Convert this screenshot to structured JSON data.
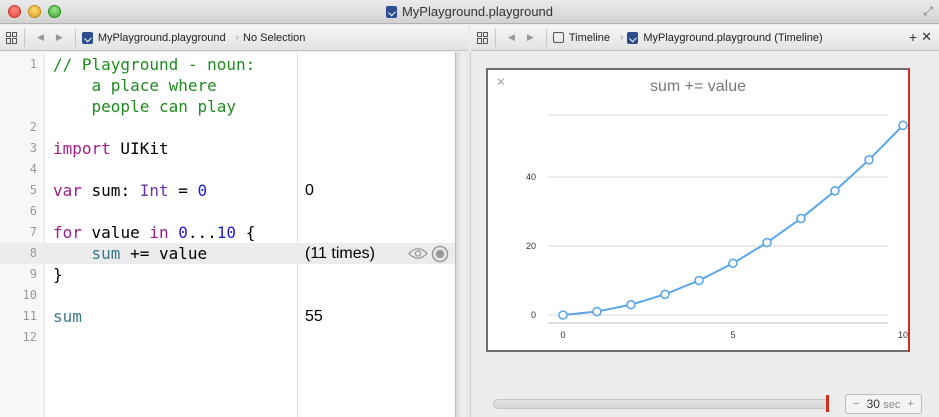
{
  "window": {
    "title": "MyPlayground.playground"
  },
  "editor_jumpbar": {
    "file": "MyPlayground.playground",
    "selection": "No Selection"
  },
  "assistant_jumpbar": {
    "mode": "Timeline",
    "file": "MyPlayground.playground (Timeline)"
  },
  "code_lines": [
    {
      "number": "1",
      "text": "// Playground - noun:"
    },
    {
      "number": "",
      "text": "    a place where"
    },
    {
      "number": "",
      "text": "    people can play"
    },
    {
      "number": "2",
      "text": ""
    },
    {
      "number": "3",
      "kw": "import",
      "rest": " UIKit"
    },
    {
      "number": "4",
      "text": ""
    },
    {
      "number": "5",
      "kw": "var",
      "a": " sum: ",
      "type": "Int",
      "b": " = ",
      "num": "0"
    },
    {
      "number": "6",
      "text": ""
    },
    {
      "number": "7",
      "kw": "for",
      "a": " value ",
      "kw2": "in",
      "b": " ",
      "num1": "0",
      "c": "...",
      "num2": "10",
      "d": " {"
    },
    {
      "number": "8",
      "ident": "sum",
      "rest": " += value"
    },
    {
      "number": "9",
      "text": "}"
    },
    {
      "number": "10",
      "text": ""
    },
    {
      "number": "11",
      "ident": "sum"
    },
    {
      "number": "12",
      "text": ""
    }
  ],
  "results": {
    "line5": "0",
    "line8": "(11 times)",
    "line11": "55"
  },
  "icons": {
    "quick_look": "eye-icon",
    "value_history": "record-circle-icon",
    "close": "close-icon",
    "add": "plus-icon"
  },
  "chart_data": {
    "type": "line",
    "title": "sum += value",
    "x": [
      0,
      1,
      2,
      3,
      4,
      5,
      6,
      7,
      8,
      9,
      10
    ],
    "series": [
      {
        "values": [
          0,
          1,
          3,
          6,
          10,
          15,
          21,
          28,
          36,
          45,
          55
        ]
      }
    ],
    "xticks": [
      0,
      5,
      10
    ],
    "yticks": [
      0,
      20,
      40
    ],
    "xlim": [
      0,
      10
    ],
    "ylim": [
      0,
      58
    ],
    "grid": true,
    "color": "#5aa6e6"
  },
  "timeline_controls": {
    "duration_value": "30",
    "duration_unit": "sec",
    "decrement": "−",
    "increment": "+"
  },
  "colors": {
    "playhead": "#d82b1f",
    "comment": "#1e8c1e",
    "keyword": "#a11d84",
    "number": "#1d1bd8"
  }
}
